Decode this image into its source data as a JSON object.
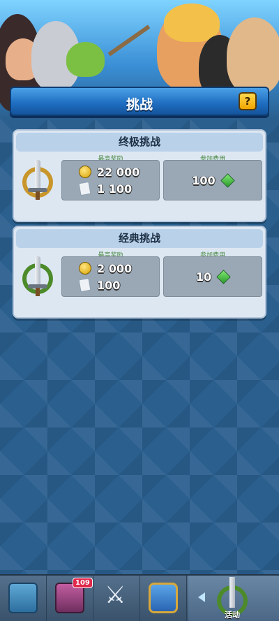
{
  "header": {
    "title": "挑战",
    "help_label": "?"
  },
  "challenges": [
    {
      "title": "终极挑战",
      "max_reward_label": "最高奖励",
      "gold": "22 000",
      "cards": "1 100",
      "entry_fee_label": "参加费用",
      "entry_fee": "100"
    },
    {
      "title": "经典挑战",
      "max_reward_label": "最高奖励",
      "gold": "2 000",
      "cards": "100",
      "entry_fee_label": "参加费用",
      "entry_fee": "10"
    }
  ],
  "bottom_nav": {
    "cards_badge": "109",
    "active_tab_label": "活动"
  },
  "colors": {
    "background": "#2a5f8e",
    "banner": "#1e6cc0",
    "card_bg": "#dde7f2",
    "card_header": "#b9d2ea",
    "panel": "#9aa8b6",
    "label_green": "#4b8a43",
    "gold_ring": "#c8962a",
    "green_ring": "#4c8a2a",
    "badge_red": "#e0284a"
  }
}
